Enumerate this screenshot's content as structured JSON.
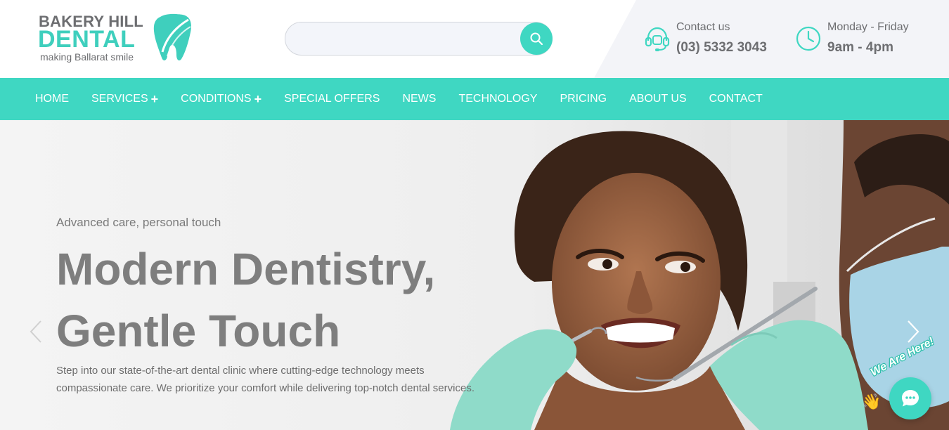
{
  "brand": {
    "line1": "BAKERY HILL",
    "line2": "DENTAL",
    "tagline": "making Ballarat smile"
  },
  "search": {
    "value": "",
    "placeholder": "",
    "button_icon": "search-icon"
  },
  "contact": {
    "phone_label": "Contact us",
    "phone_value": "(03) 5332 3043",
    "phone_icon": "headset-icon",
    "hours_label": "Monday - Friday",
    "hours_value": "9am - 4pm",
    "hours_icon": "clock-icon"
  },
  "nav": {
    "items": [
      {
        "label": "HOME",
        "has_submenu": false
      },
      {
        "label": "SERVICES",
        "has_submenu": true
      },
      {
        "label": "CONDITIONS",
        "has_submenu": true
      },
      {
        "label": "SPECIAL OFFERS",
        "has_submenu": false
      },
      {
        "label": "NEWS",
        "has_submenu": false
      },
      {
        "label": "TECHNOLOGY",
        "has_submenu": false
      },
      {
        "label": "PRICING",
        "has_submenu": false
      },
      {
        "label": "ABOUT US",
        "has_submenu": false
      },
      {
        "label": "CONTACT",
        "has_submenu": false
      }
    ],
    "submenu_symbol": "+"
  },
  "hero": {
    "eyebrow": "Advanced care, personal touch",
    "title_line1": "Modern Dentistry,",
    "title_line2": "Gentle Touch",
    "description": "Step into our state-of-the-art dental clinic where cutting-edge technology meets compassionate care. We prioritize your comfort while delivering top-notch dental services."
  },
  "slider": {
    "prev_icon": "chevron-left-icon",
    "next_icon": "chevron-right-icon"
  },
  "chat": {
    "badge_text": "We Are Here!",
    "wave_emoji": "👋",
    "button_icon": "chat-bubble-icon"
  },
  "colors": {
    "accent": "#3fd7c2",
    "text_gray": "#6d6e71",
    "hero_title": "#7e7e7e"
  }
}
